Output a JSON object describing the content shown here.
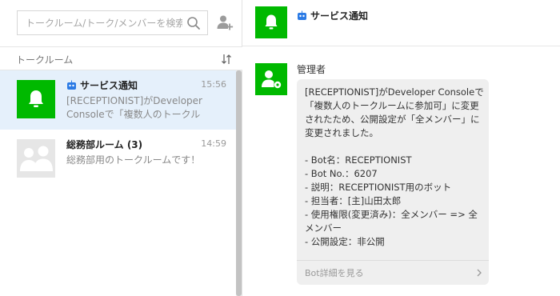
{
  "search": {
    "placeholder": "トークルーム/トーク/メンバーを検索"
  },
  "sidebar": {
    "section_label": "トークルーム",
    "rooms": [
      {
        "title": "サービス通知",
        "time": "15:56",
        "preview": "[RECEPTIONIST]がDeveloper Consoleで「複数人のトークル",
        "type": "bot",
        "active": true
      },
      {
        "title": "総務部ルーム (3)",
        "time": "14:59",
        "preview": "総務部用のトークルームです！",
        "type": "group",
        "active": false
      }
    ]
  },
  "chat": {
    "title": "サービス通知",
    "message": {
      "sender": "管理者",
      "text": "[RECEPTIONIST]がDeveloper Consoleで「複数人のトークルームに参加可」に変更されたため、公開設定が「全メンバー」に変更されました。\n\n- Bot名：RECEPTIONIST\n- Bot No.：6207\n- 説明：RECEPTIONIST用のボット\n- 担当者：[主]山田太郎\n- 使用権限(変更済み)：全メンバー => 全メンバー\n- 公開設定：非公開",
      "link_label": "Bot詳細を見る"
    }
  },
  "colors": {
    "accent_green": "#00b900",
    "active_row": "#e5f0fb",
    "bot_badge": "#2c7be5"
  },
  "icons": [
    "search-icon",
    "add-member-icon",
    "sort-icon",
    "bell-icon",
    "group-avatar-icon",
    "admin-avatar-icon",
    "bot-badge-icon",
    "chevron-right-icon"
  ]
}
